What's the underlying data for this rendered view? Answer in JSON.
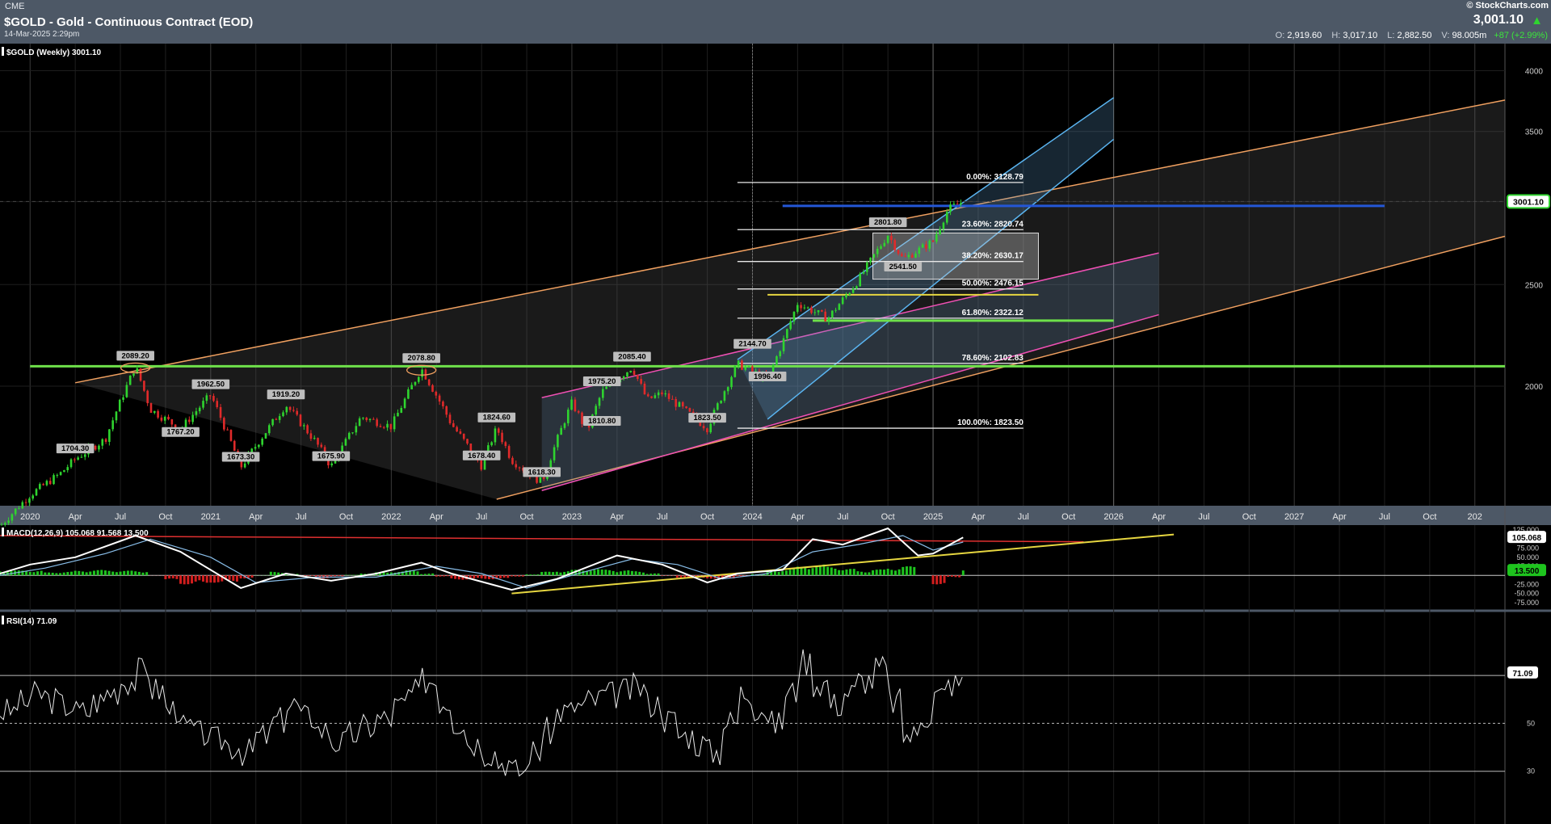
{
  "header": {
    "exchange": "CME",
    "title": "$GOLD - Gold - Continuous Contract (EOD)",
    "date": "14-Mar-2025 2:29pm",
    "brand": "© StockCharts.com",
    "last": "3,001.10",
    "ohlc": {
      "o": "2,919.60",
      "h": "3,017.10",
      "l": "2,882.50",
      "v": "98.005m",
      "chg": "+87 (+2.99%)"
    }
  },
  "colors": {
    "background": "#000000",
    "header": "#4d5866",
    "price": "#ffffff",
    "up": "#2fd42f",
    "down": "#e02a2a",
    "orange_channel": "#f0a060",
    "blue_channel": "#5ab4f0",
    "magenta_channel": "#f050b4",
    "support": "#6ee04a",
    "resistance": "#2457d6",
    "macd_signal": "#88bde8",
    "trendline": "#e6d640"
  },
  "chart_data": [
    {
      "type": "line",
      "title": "$GOLD (Weekly) 3001.10",
      "last_label": "3001.10",
      "ylim": [
        1560,
        4200
      ],
      "y_ticks": [
        2000,
        2500,
        3000,
        3500,
        4000
      ],
      "y_tick_labels": [
        "2000",
        "2500",
        "",
        "3500",
        "4000"
      ],
      "x_range": [
        "2019-11",
        "2028-03"
      ],
      "x_labels": [
        {
          "d": "2020-01",
          "t": "2020",
          "year": true
        },
        {
          "d": "2020-04",
          "t": "Apr"
        },
        {
          "d": "2020-07",
          "t": "Jul"
        },
        {
          "d": "2020-10",
          "t": "Oct"
        },
        {
          "d": "2021-01",
          "t": "2021",
          "year": true
        },
        {
          "d": "2021-04",
          "t": "Apr"
        },
        {
          "d": "2021-07",
          "t": "Jul"
        },
        {
          "d": "2021-10",
          "t": "Oct"
        },
        {
          "d": "2022-01",
          "t": "2022",
          "year": true
        },
        {
          "d": "2022-04",
          "t": "Apr"
        },
        {
          "d": "2022-07",
          "t": "Jul"
        },
        {
          "d": "2022-10",
          "t": "Oct"
        },
        {
          "d": "2023-01",
          "t": "2023",
          "year": true
        },
        {
          "d": "2023-04",
          "t": "Apr"
        },
        {
          "d": "2023-07",
          "t": "Jul"
        },
        {
          "d": "2023-10",
          "t": "Oct"
        },
        {
          "d": "2024-01",
          "t": "2024",
          "year": true
        },
        {
          "d": "2024-04",
          "t": "Apr"
        },
        {
          "d": "2024-07",
          "t": "Jul"
        },
        {
          "d": "2024-10",
          "t": "Oct"
        },
        {
          "d": "2025-01",
          "t": "2025",
          "year": true
        },
        {
          "d": "2025-04",
          "t": "Apr"
        },
        {
          "d": "2025-07",
          "t": "Jul"
        },
        {
          "d": "2025-10",
          "t": "Oct"
        },
        {
          "d": "2026-01",
          "t": "2026",
          "year": true
        },
        {
          "d": "2026-04",
          "t": "Apr"
        },
        {
          "d": "2026-07",
          "t": "Jul"
        },
        {
          "d": "2026-10",
          "t": "Oct"
        },
        {
          "d": "2027-01",
          "t": "2027",
          "year": true
        },
        {
          "d": "2027-04",
          "t": "Apr"
        },
        {
          "d": "2027-07",
          "t": "Jul"
        },
        {
          "d": "2027-10",
          "t": "Oct"
        },
        {
          "d": "2028-01",
          "t": "202",
          "year": true
        }
      ],
      "price_series": [
        {
          "d": "2019-11",
          "v": 1470
        },
        {
          "d": "2020-01",
          "v": 1575
        },
        {
          "d": "2020-03",
          "v": 1650
        },
        {
          "d": "2020-04",
          "v": 1704.3
        },
        {
          "d": "2020-06",
          "v": 1780
        },
        {
          "d": "2020-08",
          "v": 2089.2
        },
        {
          "d": "2020-09",
          "v": 1900
        },
        {
          "d": "2020-11",
          "v": 1820
        },
        {
          "d": "2021-01",
          "v": 1962.5
        },
        {
          "d": "2021-03",
          "v": 1673.3
        },
        {
          "d": "2021-06",
          "v": 1919.2
        },
        {
          "d": "2021-08",
          "v": 1767.2
        },
        {
          "d": "2021-09",
          "v": 1675.9
        },
        {
          "d": "2021-11",
          "v": 1870
        },
        {
          "d": "2022-01",
          "v": 1830
        },
        {
          "d": "2022-03",
          "v": 2078.8
        },
        {
          "d": "2022-05",
          "v": 1840
        },
        {
          "d": "2022-07",
          "v": 1678.4
        },
        {
          "d": "2022-08",
          "v": 1824.6
        },
        {
          "d": "2022-09",
          "v": 1700
        },
        {
          "d": "2022-11",
          "v": 1618.3
        },
        {
          "d": "2023-01",
          "v": 1930
        },
        {
          "d": "2023-02",
          "v": 1810
        },
        {
          "d": "2023-03",
          "v": 1975.2
        },
        {
          "d": "2023-05",
          "v": 2085.4
        },
        {
          "d": "2023-06",
          "v": 1940
        },
        {
          "d": "2023-07",
          "v": 1970
        },
        {
          "d": "2023-10",
          "v": 1823.5
        },
        {
          "d": "2023-12",
          "v": 2100
        },
        {
          "d": "2024-02",
          "v": 2030
        },
        {
          "d": "2024-03",
          "v": 2200
        },
        {
          "d": "2024-04",
          "v": 2400
        },
        {
          "d": "2024-06",
          "v": 2320
        },
        {
          "d": "2024-08",
          "v": 2520
        },
        {
          "d": "2024-10",
          "v": 2790
        },
        {
          "d": "2024-11",
          "v": 2641.5
        },
        {
          "d": "2025-01",
          "v": 2750
        },
        {
          "d": "2025-02",
          "v": 2950
        },
        {
          "d": "2025-03",
          "v": 3001.1
        }
      ],
      "annotations": [
        {
          "d": "2020-04",
          "v": 1704.3,
          "t": "1704.30"
        },
        {
          "d": "2020-08",
          "v": 2089.2,
          "t": "2089.20"
        },
        {
          "d": "2021-01",
          "v": 1962.5,
          "t": "1962.50"
        },
        {
          "d": "2020-11",
          "v": 1767.2,
          "t": "1767.20"
        },
        {
          "d": "2021-03",
          "v": 1673.3,
          "t": "1673.30"
        },
        {
          "d": "2021-06",
          "v": 1919.2,
          "t": "1919.20"
        },
        {
          "d": "2021-09",
          "v": 1675.9,
          "t": "1675.90"
        },
        {
          "d": "2022-03",
          "v": 2078.8,
          "t": "2078.80"
        },
        {
          "d": "2022-08",
          "v": 1824.6,
          "t": "1824.60"
        },
        {
          "d": "2022-07",
          "v": 1678.4,
          "t": "1678.40"
        },
        {
          "d": "2022-11",
          "v": 1618.3,
          "t": "1618.30"
        },
        {
          "d": "2023-03",
          "v": 1975.2,
          "t": "1975.20"
        },
        {
          "d": "2023-05",
          "v": 2085.4,
          "t": "2085.40"
        },
        {
          "d": "2023-03",
          "v": 1810.8,
          "t": "1810.80"
        },
        {
          "d": "2023-10",
          "v": 1823.5,
          "t": "1823.50"
        },
        {
          "d": "2024-01",
          "v": 2144.7,
          "t": "2144.70"
        },
        {
          "d": "2024-02",
          "v": 1996.4,
          "t": "1996.40"
        },
        {
          "d": "2024-10",
          "v": 2801.8,
          "t": "2801.80"
        },
        {
          "d": "2024-11",
          "v": 2541.5,
          "t": "2541.50"
        }
      ],
      "fib_levels": [
        {
          "v": 3128.79,
          "t": "0.00%: 3128.79"
        },
        {
          "v": 2820.74,
          "t": "23.60%: 2820.74"
        },
        {
          "v": 2630.17,
          "t": "38.20%: 2630.17"
        },
        {
          "v": 2476.15,
          "t": "50.00%: 2476.15"
        },
        {
          "v": 2322.12,
          "t": "61.80%: 2322.12"
        },
        {
          "v": 2102.83,
          "t": "78.60%: 2102.83"
        },
        {
          "v": 1823.5,
          "t": "100.00%: 1823.50"
        }
      ],
      "fib_range": [
        "2023-12",
        "2025-07"
      ],
      "orange_channel": {
        "upper": [
          [
            "2020-04",
            2015
          ],
          [
            "2028-03",
            3750
          ]
        ],
        "lower": [
          [
            "2022-08",
            1560
          ],
          [
            "2028-03",
            2780
          ]
        ]
      },
      "blue_channel": {
        "upper": [
          [
            "2023-12",
            2120
          ],
          [
            "2026-01",
            3770
          ]
        ],
        "lower": [
          [
            "2024-02",
            1860
          ],
          [
            "2026-01",
            3440
          ]
        ]
      },
      "magenta_channel": {
        "upper": [
          [
            "2022-11",
            1950
          ],
          [
            "2026-04",
            2680
          ]
        ],
        "lower": [
          [
            "2022-11",
            1590
          ],
          [
            "2026-04",
            2340
          ]
        ]
      },
      "support_line": {
        "v": 2089.2,
        "from": "2020-01",
        "to": "2028-03"
      },
      "resistance_line": {
        "v": 2972,
        "from": "2024-03",
        "to": "2027-07"
      },
      "short_green_line": {
        "v": 2310,
        "from": "2024-05",
        "to": "2026-01"
      },
      "short_yellow_line": {
        "v": 2445,
        "from": "2024-02",
        "to": "2025-08"
      },
      "rect_zone": {
        "from": "2024-09",
        "to": "2025-08",
        "top": 2800,
        "bottom": 2530
      }
    },
    {
      "type": "line",
      "title": "MACD(12,26,9)",
      "values_text": "105.068  91.568  13.500",
      "ylim": [
        -80,
        130
      ],
      "tick_labels": [
        "125.000",
        "100.000",
        "75.000",
        "50.000",
        "25.000",
        "-25.000",
        "-50.000",
        "-75.000"
      ],
      "tick_values": [
        125,
        100,
        75,
        50,
        25,
        -25,
        -50,
        -75
      ],
      "last_labels": [
        {
          "v": 105.068,
          "t": "105.068",
          "kind": "macd"
        },
        {
          "v": 13.5,
          "t": "13.500",
          "kind": "hist"
        }
      ],
      "series": [
        {
          "name": "MACD",
          "points": [
            [
              "2019-11",
              5
            ],
            [
              "2020-01",
              30
            ],
            [
              "2020-04",
              50
            ],
            [
              "2020-08",
              110
            ],
            [
              "2020-11",
              65
            ],
            [
              "2021-03",
              -35
            ],
            [
              "2021-06",
              5
            ],
            [
              "2021-09",
              -15
            ],
            [
              "2021-12",
              5
            ],
            [
              "2022-03",
              35
            ],
            [
              "2022-05",
              5
            ],
            [
              "2022-09",
              -40
            ],
            [
              "2022-12",
              -10
            ],
            [
              "2023-04",
              55
            ],
            [
              "2023-07",
              30
            ],
            [
              "2023-10",
              -20
            ],
            [
              "2023-12",
              5
            ],
            [
              "2024-03",
              15
            ],
            [
              "2024-05",
              100
            ],
            [
              "2024-07",
              85
            ],
            [
              "2024-10",
              130
            ],
            [
              "2024-12",
              55
            ],
            [
              "2025-01",
              60
            ],
            [
              "2025-03",
              105
            ]
          ]
        },
        {
          "name": "Signal",
          "points": [
            [
              "2019-11",
              0
            ],
            [
              "2020-02",
              20
            ],
            [
              "2020-06",
              60
            ],
            [
              "2020-09",
              100
            ],
            [
              "2021-01",
              50
            ],
            [
              "2021-04",
              -20
            ],
            [
              "2021-08",
              -5
            ],
            [
              "2021-12",
              -5
            ],
            [
              "2022-04",
              25
            ],
            [
              "2022-07",
              5
            ],
            [
              "2022-10",
              -35
            ],
            [
              "2023-01",
              0
            ],
            [
              "2023-05",
              45
            ],
            [
              "2023-08",
              30
            ],
            [
              "2023-11",
              -10
            ],
            [
              "2024-02",
              5
            ],
            [
              "2024-05",
              65
            ],
            [
              "2024-08",
              85
            ],
            [
              "2024-11",
              110
            ],
            [
              "2025-01",
              70
            ],
            [
              "2025-03",
              92
            ]
          ]
        }
      ],
      "histogram": [
        [
          "2020-02",
          8
        ],
        [
          "2020-05",
          15
        ],
        [
          "2020-08",
          12
        ],
        [
          "2020-11",
          -25
        ],
        [
          "2021-02",
          -18
        ],
        [
          "2021-05",
          10
        ],
        [
          "2021-08",
          -8
        ],
        [
          "2021-11",
          6
        ],
        [
          "2022-02",
          14
        ],
        [
          "2022-05",
          -12
        ],
        [
          "2022-08",
          -10
        ],
        [
          "2022-11",
          10
        ],
        [
          "2023-02",
          18
        ],
        [
          "2023-05",
          12
        ],
        [
          "2023-08",
          -8
        ],
        [
          "2023-11",
          -10
        ],
        [
          "2024-02",
          12
        ],
        [
          "2024-05",
          30
        ],
        [
          "2024-08",
          12
        ],
        [
          "2024-11",
          25
        ],
        [
          "2025-01",
          -25
        ],
        [
          "2025-03",
          13.5
        ]
      ],
      "red_line": [
        [
          "2019-11",
          110
        ],
        [
          "2025-11",
          93
        ]
      ],
      "yellow_line": [
        [
          "2022-09",
          -50
        ],
        [
          "2026-05",
          113
        ]
      ],
      "zero_line": 0
    },
    {
      "type": "line",
      "title": "RSI(14)",
      "values_text": "71.09",
      "ylim": [
        10,
        95
      ],
      "tick_labels": [
        "70",
        "50",
        "30"
      ],
      "tick_values": [
        70,
        50,
        30
      ],
      "last_label": {
        "v": 71.09,
        "t": "71.09"
      },
      "series": [
        {
          "name": "RSI",
          "points": [
            [
              "2019-11",
              55
            ],
            [
              "2020-01",
              62
            ],
            [
              "2020-04",
              55
            ],
            [
              "2020-08",
              72
            ],
            [
              "2020-11",
              48
            ],
            [
              "2021-03",
              38
            ],
            [
              "2021-06",
              58
            ],
            [
              "2021-09",
              42
            ],
            [
              "2021-12",
              52
            ],
            [
              "2022-03",
              68
            ],
            [
              "2022-06",
              42
            ],
            [
              "2022-09",
              30
            ],
            [
              "2022-12",
              55
            ],
            [
              "2023-03",
              62
            ],
            [
              "2023-05",
              65
            ],
            [
              "2023-08",
              45
            ],
            [
              "2023-10",
              38
            ],
            [
              "2023-12",
              63
            ],
            [
              "2024-02",
              50
            ],
            [
              "2024-04",
              76
            ],
            [
              "2024-06",
              58
            ],
            [
              "2024-09",
              73
            ],
            [
              "2024-11",
              45
            ],
            [
              "2025-01",
              62
            ],
            [
              "2025-03",
              71.09
            ]
          ]
        }
      ]
    }
  ]
}
